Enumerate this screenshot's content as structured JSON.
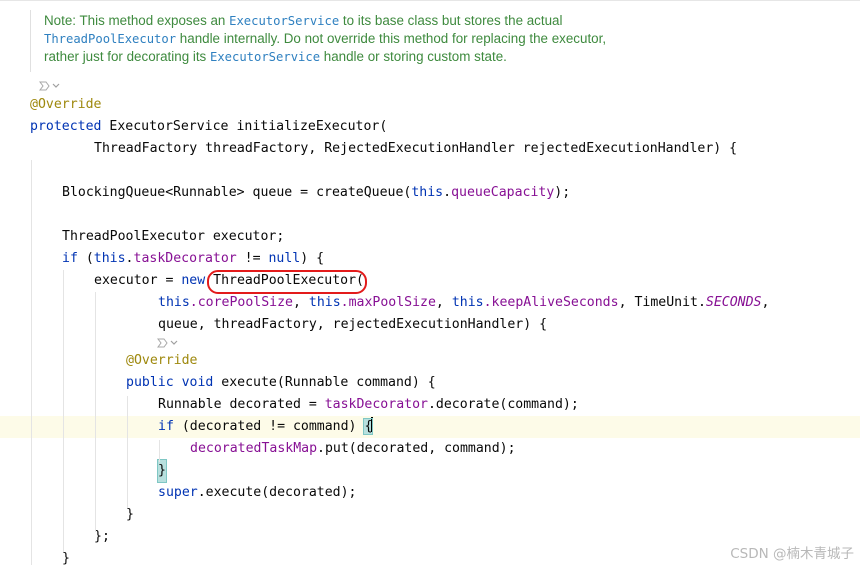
{
  "doc": {
    "line1_a": "Note: This method exposes an ",
    "line1_code": "ExecutorService",
    "line1_b": " to its base class but stores the actual",
    "line2_code": "ThreadPoolExecutor",
    "line2_b": " handle internally. Do not override this method for replacing the executor,",
    "line3_a": "rather just for decorating its ",
    "line3_code": "ExecutorService",
    "line3_b": " handle or storing custom state."
  },
  "hint_icon": "ai-suggestion-icon",
  "code": {
    "override": "@Override",
    "l2_kw": "protected",
    "l2_rest": " ExecutorService initializeExecutor(",
    "l3": "ThreadFactory threadFactory, RejectedExecutionHandler rejectedExecutionHandler) {",
    "l5_a": "BlockingQueue<Runnable> queue = createQueue(",
    "l5_kw": "this",
    "l5_dot": ".",
    "l5_fd": "queueCapacity",
    "l5_end": ");",
    "l7": "ThreadPoolExecutor executor;",
    "l8_kw": "if",
    "l8_a": " (",
    "l8_this": "this",
    "l8_dot": ".",
    "l8_fd": "taskDecorator",
    "l8_b": " != ",
    "l8_null": "null",
    "l8_end": ") {",
    "l9_a": "executor = ",
    "l9_new": "new",
    "l9_sp": " ",
    "l9_cls": "ThreadPoolExecutor(",
    "l10_this1": "this",
    "l10_f1": ".corePoolSize",
    "l10_c1": ", ",
    "l10_this2": "this",
    "l10_f2": ".maxPoolSize",
    "l10_c2": ", ",
    "l10_this3": "this",
    "l10_f3": ".keepAliveSeconds",
    "l10_c3": ", TimeUnit.",
    "l10_st": "SECONDS",
    "l10_end": ",",
    "l11": "queue, threadFactory, rejectedExecutionHandler) {",
    "l13_kw1": "public",
    "l13_sp": " ",
    "l13_kw2": "void",
    "l13_rest": " execute(Runnable command) {",
    "l14_a": "Runnable decorated = ",
    "l14_fd": "taskDecorator",
    "l14_end": ".decorate(command);",
    "l15_kw": "if",
    "l15_rest": " (decorated != command) ",
    "l15_brace": "{",
    "l16_fd": "decoratedTaskMap",
    "l16_end": ".put(decorated, command);",
    "l17_brace": "}",
    "l18_kw": "super",
    "l18_end": ".execute(decorated);",
    "l19": "}",
    "l20": "};",
    "l21": "}"
  },
  "colors": {
    "keyword": "#0033b3",
    "annotation": "#9e880d",
    "field": "#871094",
    "doc_text": "#3e8a3e",
    "highlight_circle": "#e31b1b"
  },
  "watermark": "CSDN @楠木青城子"
}
